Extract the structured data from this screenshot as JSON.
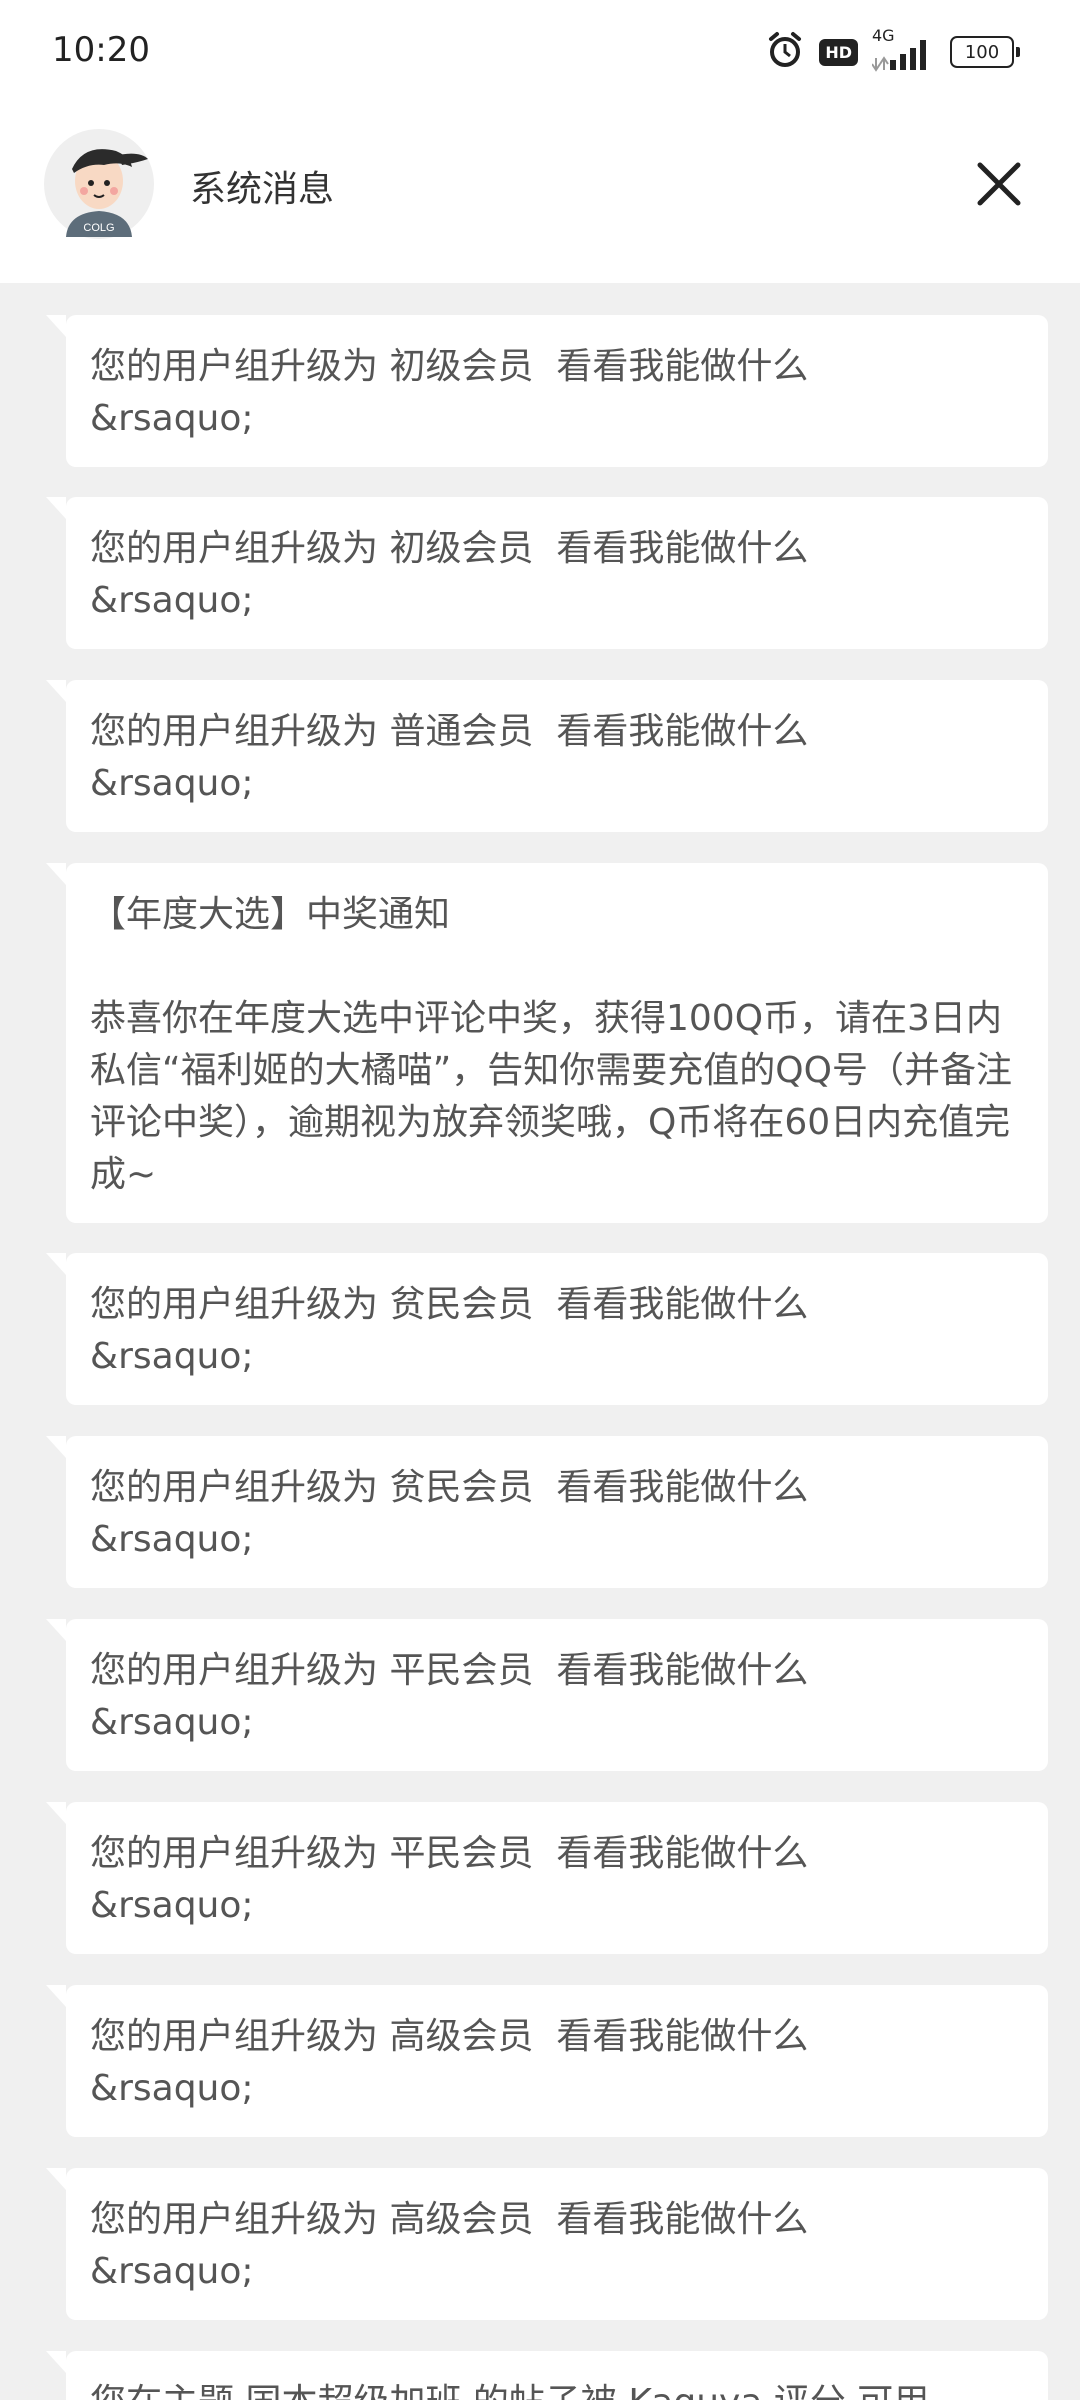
{
  "status_bar": {
    "time": "10:20",
    "hd": "HD",
    "network": "4G",
    "battery": "100"
  },
  "header": {
    "title": "系统消息",
    "avatar_text": "COLG",
    "close_icon": "close-icon"
  },
  "messages": [
    {
      "text": "您的用户组升级为 初级会员  看看我能做什么\n&rsaquo;"
    },
    {
      "text": "您的用户组升级为 初级会员  看看我能做什么\n&rsaquo;"
    },
    {
      "text": "您的用户组升级为 普通会员  看看我能做什么\n&rsaquo;"
    },
    {
      "text": "【年度大选】中奖通知\n\n恭喜你在年度大选中评论中奖，获得100Q币，请在3日内私信“福利姬的大橘喵”，告知你需要充值的QQ号（并备注评论中奖），逾期视为放弃领奖哦，Q币将在60日内充值完成~"
    },
    {
      "text": "您的用户组升级为 贫民会员  看看我能做什么\n&rsaquo;"
    },
    {
      "text": "您的用户组升级为 贫民会员  看看我能做什么\n&rsaquo;"
    },
    {
      "text": "您的用户组升级为 平民会员  看看我能做什么\n&rsaquo;"
    },
    {
      "text": "您的用户组升级为 平民会员  看看我能做什么\n&rsaquo;"
    },
    {
      "text": "您的用户组升级为 高级会员  看看我能做什么\n&rsaquo;"
    },
    {
      "text": "您的用户组升级为 高级会员  看看我能做什么\n&rsaquo;"
    },
    {
      "text": "您在主题 国本超级加班 的帖子被 Kaguya 评分 可用"
    }
  ]
}
